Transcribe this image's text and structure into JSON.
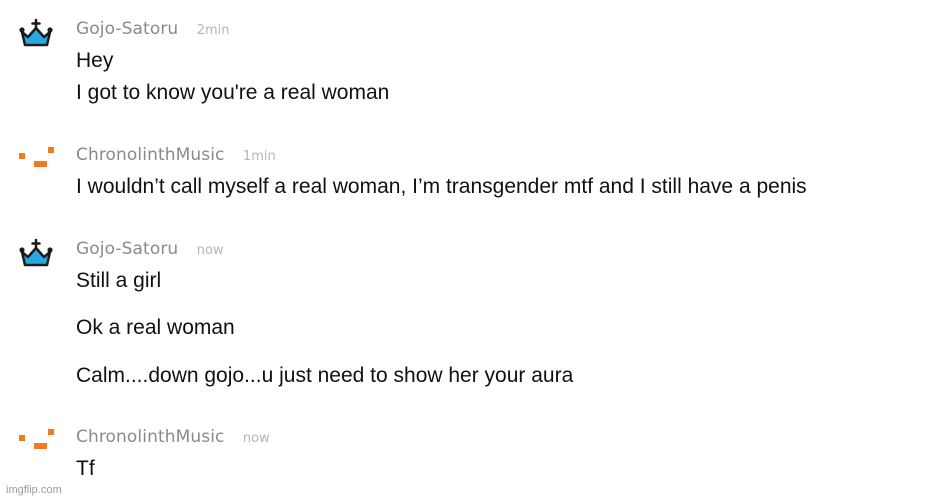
{
  "messages": [
    {
      "user": "Gojo-Satoru",
      "time": "2min",
      "avatar": "crown-icon",
      "lines": [
        "Hey",
        "I got to know you're a real woman"
      ]
    },
    {
      "user": "ChronolinthMusic",
      "time": "1min",
      "avatar": "orange-blocks-icon",
      "lines": [
        "I wouldn’t call myself a real woman, I’m transgender mtf and I still have a penis"
      ]
    },
    {
      "user": "Gojo-Satoru",
      "time": "now",
      "avatar": "crown-icon",
      "lines": [
        "Still a girl",
        "Ok a real woman",
        "Calm....down gojo...u just need to show her your aura"
      ]
    },
    {
      "user": "ChronolinthMusic",
      "time": "now",
      "avatar": "orange-blocks-icon",
      "lines": [
        "Tf"
      ]
    }
  ],
  "watermark": "imgflip.com",
  "colors": {
    "crown": "#29a9e0",
    "crown_outline": "#1b1b1b",
    "blocks": "#f47a1f",
    "username": "#8a8a8a",
    "timestamp": "#b5b5b5"
  }
}
